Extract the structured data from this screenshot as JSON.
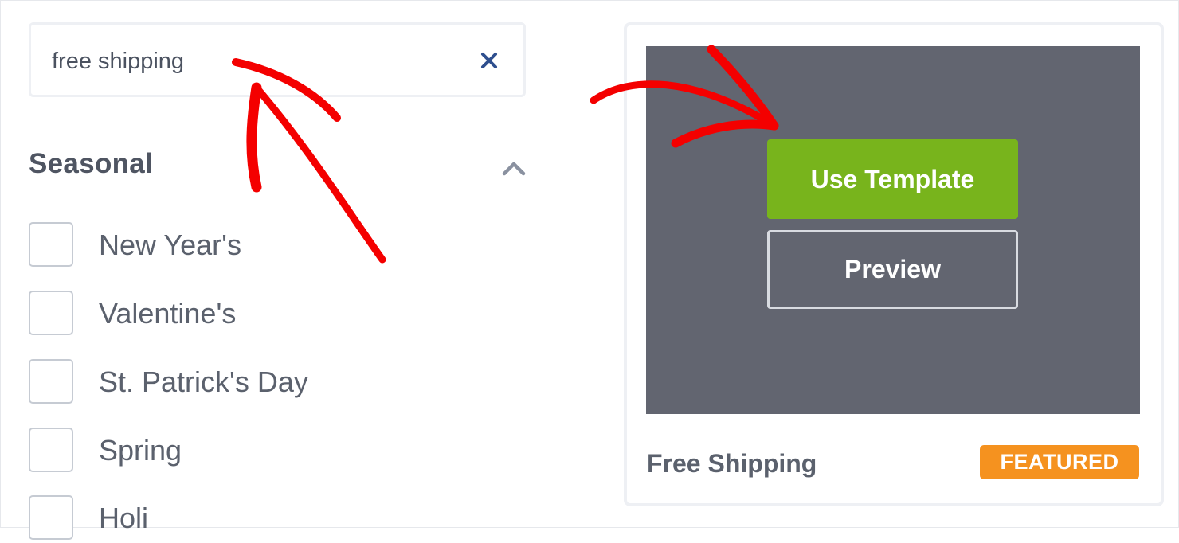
{
  "search": {
    "value": "free shipping",
    "clear_icon": "close-icon"
  },
  "seasonal": {
    "title": "Seasonal",
    "toggle_icon": "chevron-up-icon",
    "items": [
      {
        "label": "New Year's",
        "checked": false
      },
      {
        "label": "Valentine's",
        "checked": false
      },
      {
        "label": "St. Patrick's Day",
        "checked": false
      },
      {
        "label": "Spring",
        "checked": false
      },
      {
        "label": "Holi",
        "checked": false
      }
    ]
  },
  "template_card": {
    "use_template_label": "Use Template",
    "preview_label": "Preview",
    "name": "Free Shipping",
    "badge": "FEATURED"
  },
  "colors": {
    "accent_green": "#78b41c",
    "badge_orange": "#f5921f",
    "thumbnail_gray": "#626570",
    "annotation_red": "#f40000",
    "clear_icon_blue": "#2e4f8e"
  },
  "annotations": {
    "arrows": [
      "red-arrow-icon",
      "red-arrow-icon"
    ]
  }
}
